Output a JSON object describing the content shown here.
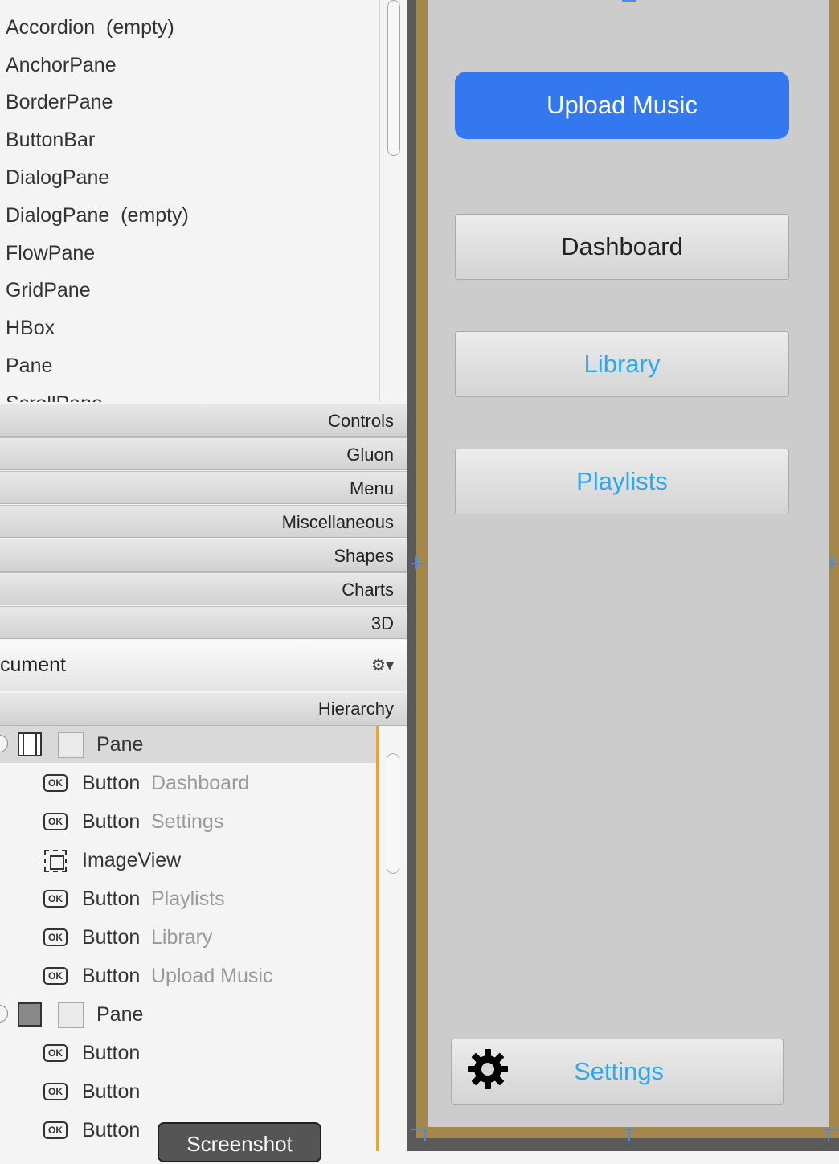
{
  "library": {
    "items": [
      "Accordion  (empty)",
      "AnchorPane",
      "BorderPane",
      "ButtonBar",
      "DialogPane",
      "DialogPane  (empty)",
      "FlowPane",
      "GridPane",
      "HBox",
      "Pane",
      "ScrollPane"
    ]
  },
  "categories": [
    "Controls",
    "Gluon",
    "Menu",
    "Miscellaneous",
    "Shapes",
    "Charts",
    "3D"
  ],
  "document": {
    "title": "cument",
    "gear_icon": "gear-icon",
    "hierarchy_label": "Hierarchy"
  },
  "tree": {
    "pane1": "Pane",
    "pane1_children": [
      {
        "type": "Button",
        "text": "Dashboard",
        "icon": "ok-button-icon"
      },
      {
        "type": "Button",
        "text": "Settings",
        "icon": "ok-button-icon"
      },
      {
        "type": "ImageView",
        "text": "",
        "icon": "imageview-icon"
      },
      {
        "type": "Button",
        "text": "Playlists",
        "icon": "ok-button-icon"
      },
      {
        "type": "Button",
        "text": "Library",
        "icon": "ok-button-icon"
      },
      {
        "type": "Button",
        "text": "Upload Music",
        "icon": "ok-button-icon"
      }
    ],
    "pane2": "Pane",
    "pane2_children": [
      {
        "type": "Button",
        "text": "",
        "icon": "ok-button-icon"
      },
      {
        "type": "Button",
        "text": "",
        "icon": "ok-button-icon"
      },
      {
        "type": "Button",
        "text": "",
        "icon": "ok-button-icon"
      }
    ],
    "ok_icon_text": "OK"
  },
  "screenshot_button": "Screenshot",
  "canvas": {
    "upload": "Upload Music",
    "dashboard": "Dashboard",
    "library": "Library",
    "playlists": "Playlists",
    "settings": "Settings",
    "colors": {
      "accent": "#3478f0",
      "link": "#2ea8ee",
      "frame": "#a5874b"
    }
  }
}
